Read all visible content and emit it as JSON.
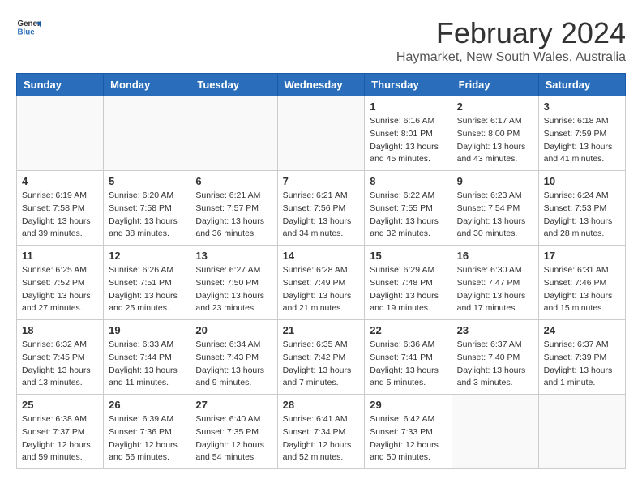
{
  "app": {
    "logo_general": "General",
    "logo_blue": "Blue"
  },
  "header": {
    "month": "February 2024",
    "location": "Haymarket, New South Wales, Australia"
  },
  "weekdays": [
    "Sunday",
    "Monday",
    "Tuesday",
    "Wednesday",
    "Thursday",
    "Friday",
    "Saturday"
  ],
  "weeks": [
    [
      {
        "day": "",
        "info": ""
      },
      {
        "day": "",
        "info": ""
      },
      {
        "day": "",
        "info": ""
      },
      {
        "day": "",
        "info": ""
      },
      {
        "day": "1",
        "info": "Sunrise: 6:16 AM\nSunset: 8:01 PM\nDaylight: 13 hours\nand 45 minutes."
      },
      {
        "day": "2",
        "info": "Sunrise: 6:17 AM\nSunset: 8:00 PM\nDaylight: 13 hours\nand 43 minutes."
      },
      {
        "day": "3",
        "info": "Sunrise: 6:18 AM\nSunset: 7:59 PM\nDaylight: 13 hours\nand 41 minutes."
      }
    ],
    [
      {
        "day": "4",
        "info": "Sunrise: 6:19 AM\nSunset: 7:58 PM\nDaylight: 13 hours\nand 39 minutes."
      },
      {
        "day": "5",
        "info": "Sunrise: 6:20 AM\nSunset: 7:58 PM\nDaylight: 13 hours\nand 38 minutes."
      },
      {
        "day": "6",
        "info": "Sunrise: 6:21 AM\nSunset: 7:57 PM\nDaylight: 13 hours\nand 36 minutes."
      },
      {
        "day": "7",
        "info": "Sunrise: 6:21 AM\nSunset: 7:56 PM\nDaylight: 13 hours\nand 34 minutes."
      },
      {
        "day": "8",
        "info": "Sunrise: 6:22 AM\nSunset: 7:55 PM\nDaylight: 13 hours\nand 32 minutes."
      },
      {
        "day": "9",
        "info": "Sunrise: 6:23 AM\nSunset: 7:54 PM\nDaylight: 13 hours\nand 30 minutes."
      },
      {
        "day": "10",
        "info": "Sunrise: 6:24 AM\nSunset: 7:53 PM\nDaylight: 13 hours\nand 28 minutes."
      }
    ],
    [
      {
        "day": "11",
        "info": "Sunrise: 6:25 AM\nSunset: 7:52 PM\nDaylight: 13 hours\nand 27 minutes."
      },
      {
        "day": "12",
        "info": "Sunrise: 6:26 AM\nSunset: 7:51 PM\nDaylight: 13 hours\nand 25 minutes."
      },
      {
        "day": "13",
        "info": "Sunrise: 6:27 AM\nSunset: 7:50 PM\nDaylight: 13 hours\nand 23 minutes."
      },
      {
        "day": "14",
        "info": "Sunrise: 6:28 AM\nSunset: 7:49 PM\nDaylight: 13 hours\nand 21 minutes."
      },
      {
        "day": "15",
        "info": "Sunrise: 6:29 AM\nSunset: 7:48 PM\nDaylight: 13 hours\nand 19 minutes."
      },
      {
        "day": "16",
        "info": "Sunrise: 6:30 AM\nSunset: 7:47 PM\nDaylight: 13 hours\nand 17 minutes."
      },
      {
        "day": "17",
        "info": "Sunrise: 6:31 AM\nSunset: 7:46 PM\nDaylight: 13 hours\nand 15 minutes."
      }
    ],
    [
      {
        "day": "18",
        "info": "Sunrise: 6:32 AM\nSunset: 7:45 PM\nDaylight: 13 hours\nand 13 minutes."
      },
      {
        "day": "19",
        "info": "Sunrise: 6:33 AM\nSunset: 7:44 PM\nDaylight: 13 hours\nand 11 minutes."
      },
      {
        "day": "20",
        "info": "Sunrise: 6:34 AM\nSunset: 7:43 PM\nDaylight: 13 hours\nand 9 minutes."
      },
      {
        "day": "21",
        "info": "Sunrise: 6:35 AM\nSunset: 7:42 PM\nDaylight: 13 hours\nand 7 minutes."
      },
      {
        "day": "22",
        "info": "Sunrise: 6:36 AM\nSunset: 7:41 PM\nDaylight: 13 hours\nand 5 minutes."
      },
      {
        "day": "23",
        "info": "Sunrise: 6:37 AM\nSunset: 7:40 PM\nDaylight: 13 hours\nand 3 minutes."
      },
      {
        "day": "24",
        "info": "Sunrise: 6:37 AM\nSunset: 7:39 PM\nDaylight: 13 hours\nand 1 minute."
      }
    ],
    [
      {
        "day": "25",
        "info": "Sunrise: 6:38 AM\nSunset: 7:37 PM\nDaylight: 12 hours\nand 59 minutes."
      },
      {
        "day": "26",
        "info": "Sunrise: 6:39 AM\nSunset: 7:36 PM\nDaylight: 12 hours\nand 56 minutes."
      },
      {
        "day": "27",
        "info": "Sunrise: 6:40 AM\nSunset: 7:35 PM\nDaylight: 12 hours\nand 54 minutes."
      },
      {
        "day": "28",
        "info": "Sunrise: 6:41 AM\nSunset: 7:34 PM\nDaylight: 12 hours\nand 52 minutes."
      },
      {
        "day": "29",
        "info": "Sunrise: 6:42 AM\nSunset: 7:33 PM\nDaylight: 12 hours\nand 50 minutes."
      },
      {
        "day": "",
        "info": ""
      },
      {
        "day": "",
        "info": ""
      }
    ]
  ]
}
